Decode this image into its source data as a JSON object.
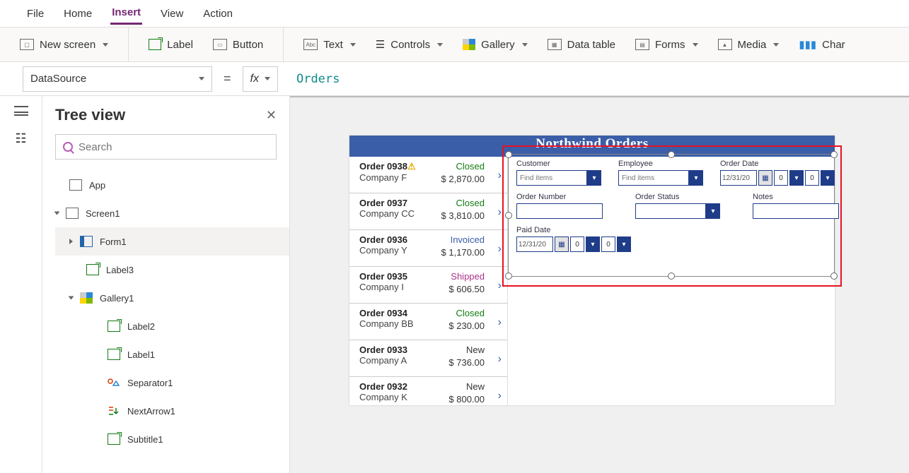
{
  "menu": {
    "items": [
      "File",
      "Home",
      "Insert",
      "View",
      "Action"
    ],
    "active": "Insert"
  },
  "ribbon": {
    "newScreen": "New screen",
    "label": "Label",
    "button": "Button",
    "text": "Text",
    "controls": "Controls",
    "gallery": "Gallery",
    "dataTable": "Data table",
    "forms": "Forms",
    "media": "Media",
    "charts": "Char"
  },
  "formulaBar": {
    "property": "DataSource",
    "value": "Orders"
  },
  "treePanel": {
    "title": "Tree view",
    "searchPlaceholder": "Search",
    "nodes": {
      "app": "App",
      "screen1": "Screen1",
      "form1": "Form1",
      "label3": "Label3",
      "gallery1": "Gallery1",
      "label2": "Label2",
      "label1": "Label1",
      "separator1": "Separator1",
      "nextArrow1": "NextArrow1",
      "subtitle1": "Subtitle1"
    }
  },
  "preview": {
    "title": "Northwind Orders",
    "gallery": [
      {
        "order": "Order 0938",
        "warn": true,
        "company": "Company F",
        "status": "Closed",
        "amount": "$ 2,870.00"
      },
      {
        "order": "Order 0937",
        "warn": false,
        "company": "Company CC",
        "status": "Closed",
        "amount": "$ 3,810.00"
      },
      {
        "order": "Order 0936",
        "warn": false,
        "company": "Company Y",
        "status": "Invoiced",
        "amount": "$ 1,170.00"
      },
      {
        "order": "Order 0935",
        "warn": false,
        "company": "Company I",
        "status": "Shipped",
        "amount": "$ 606.50"
      },
      {
        "order": "Order 0934",
        "warn": false,
        "company": "Company BB",
        "status": "Closed",
        "amount": "$ 230.00"
      },
      {
        "order": "Order 0933",
        "warn": false,
        "company": "Company A",
        "status": "New",
        "amount": "$ 736.00"
      },
      {
        "order": "Order 0932",
        "warn": false,
        "company": "Company K",
        "status": "New",
        "amount": "$ 800.00"
      }
    ],
    "form": {
      "labels": {
        "customer": "Customer",
        "employee": "Employee",
        "orderDate": "Order Date",
        "orderNumber": "Order Number",
        "orderStatus": "Order Status",
        "notes": "Notes",
        "paidDate": "Paid Date"
      },
      "placeholders": {
        "findItems": "Find items"
      },
      "values": {
        "orderDate": "12/31/20",
        "paidDate": "12/31/20",
        "hourDefault": "0"
      }
    }
  }
}
